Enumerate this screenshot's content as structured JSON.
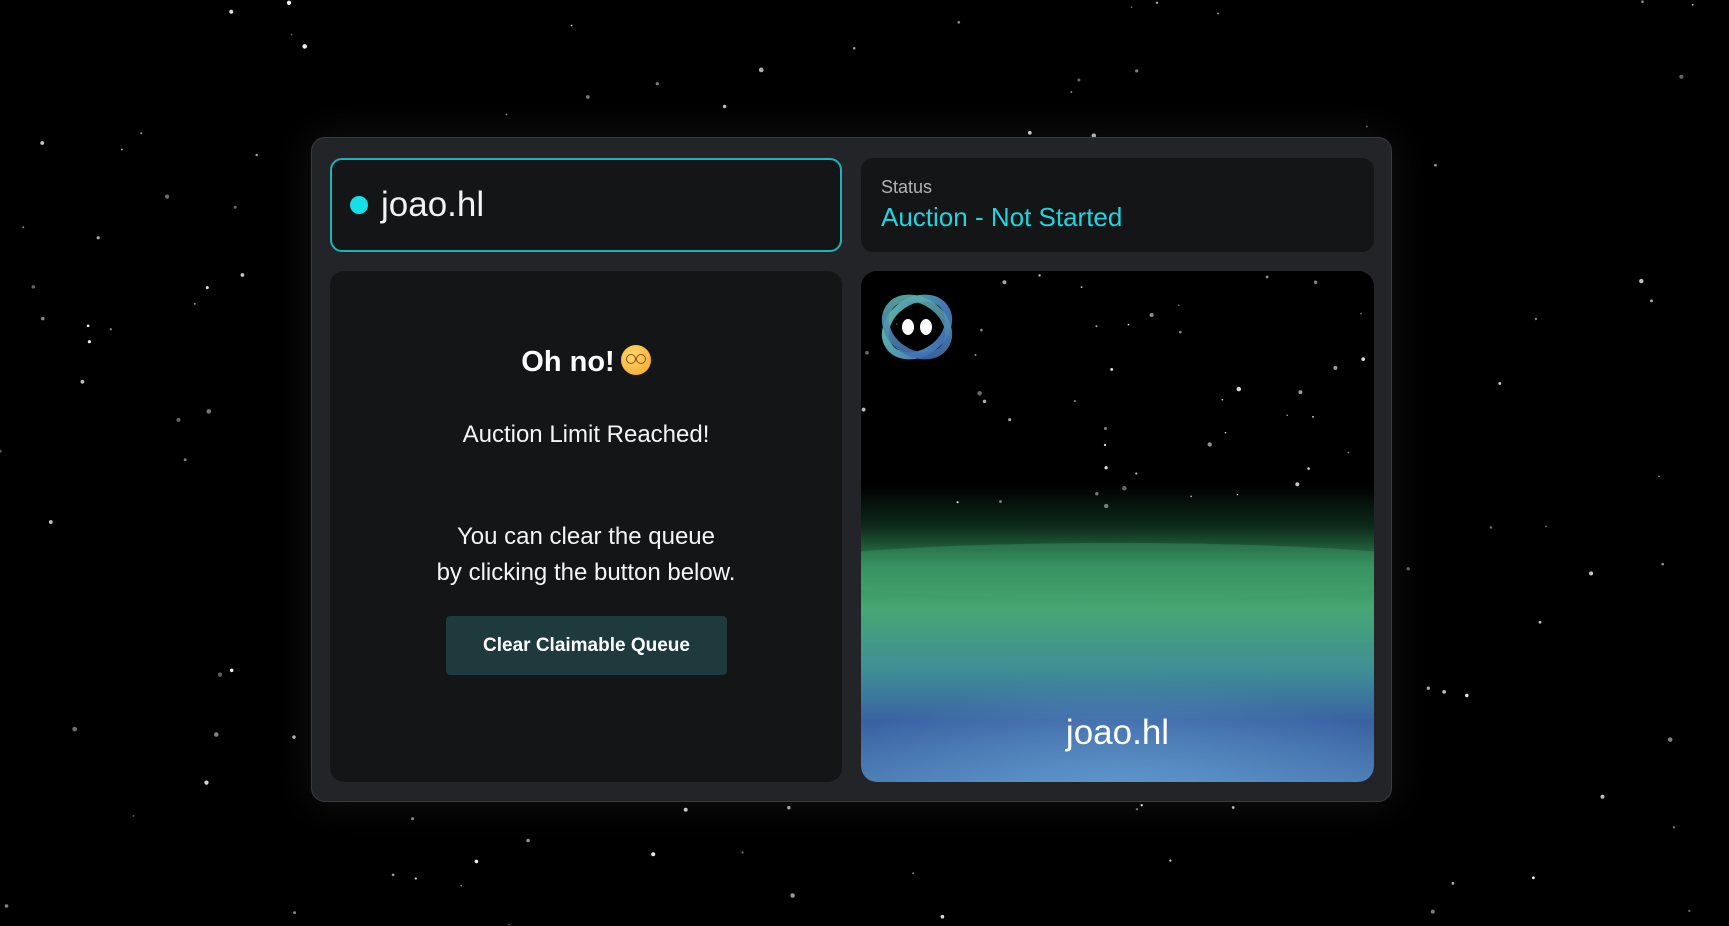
{
  "domain_name": {
    "name": "joao.hl"
  },
  "status": {
    "label": "Status",
    "value": "Auction - Not Started",
    "color": "#25d3de"
  },
  "message": {
    "title": "Oh no!",
    "emoji_name": "woozy-face-emoji",
    "subtitle": "Auction Limit Reached!",
    "body_line1": "You can clear the queue",
    "body_line2": "by clicking the button below.",
    "button_label": "Clear Claimable Queue"
  },
  "artwork": {
    "name": "joao.hl",
    "logo_icon": "avatar-logo-icon"
  },
  "colors": {
    "accent": "#16dfe9",
    "panel": "#232427",
    "card": "#141516",
    "button": "#1e3a3d",
    "aurora_green": "#47a673",
    "aurora_blue": "#3c63a0"
  }
}
